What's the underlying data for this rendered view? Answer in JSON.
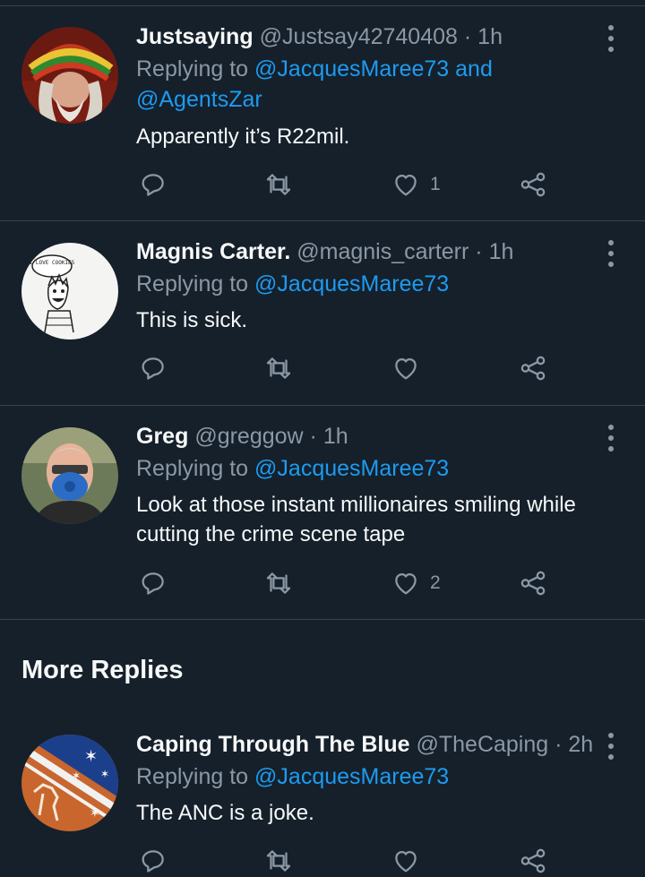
{
  "tweets": [
    {
      "name": "Justsaying",
      "handle": "@Justsay42740408",
      "time": "1h",
      "replying_prefix": "Replying to",
      "reply_to_1": "@JacquesMaree73",
      "reply_and": "and",
      "reply_to_2": "@AgentsZar",
      "text": "Apparently it’s R22mil.",
      "like_count": "1"
    },
    {
      "name": "Magnis Carter.",
      "handle": "@magnis_carterr",
      "time": "1h",
      "replying_prefix": "Replying to",
      "reply_to_1": "@JacquesMaree73",
      "text": "This is sick.",
      "like_count": ""
    },
    {
      "name": "Greg",
      "handle": "@greggow",
      "time": "1h",
      "replying_prefix": "Replying to",
      "reply_to_1": "@JacquesMaree73",
      "text": "Look at those instant millionaires smiling while cutting the crime scene tape",
      "like_count": "2"
    },
    {
      "name": "Caping Through The Blue",
      "handle": "@TheCaping",
      "time": "2h",
      "replying_prefix": "Replying to",
      "reply_to_1": "@JacquesMaree73",
      "text": "The ANC is a joke.",
      "like_count": ""
    }
  ],
  "section": {
    "more_replies": "More Replies"
  },
  "avatar_text": {
    "magnis_bubble": "I LOVE COOKIES"
  },
  "separator": "·",
  "icons": [
    "reply-icon",
    "retweet-icon",
    "like-icon",
    "share-icon",
    "more-options-icon"
  ],
  "colors": {
    "background": "#15202b",
    "link": "#1d9bf0",
    "muted": "#8b98a5",
    "text": "#f7f9f9",
    "divider": "#38444d"
  }
}
